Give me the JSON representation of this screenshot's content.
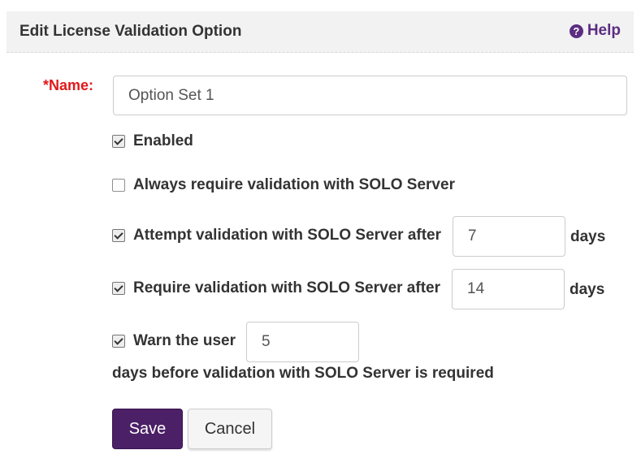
{
  "header": {
    "title": "Edit License Validation Option",
    "help_label": "Help",
    "help_icon": "question-circle-icon"
  },
  "form": {
    "name_label": "*Name:",
    "name_value": "Option Set 1",
    "enabled": {
      "label": "Enabled",
      "checked": true
    },
    "always_require": {
      "label": "Always require validation with SOLO Server",
      "checked": false
    },
    "attempt": {
      "label": "Attempt validation with SOLO Server after",
      "value": "7",
      "unit": "days",
      "checked": true
    },
    "require": {
      "label": "Require validation with SOLO Server after",
      "value": "14",
      "unit": "days",
      "checked": true
    },
    "warn": {
      "label": "Warn the user",
      "value": "5",
      "trailing": "days before validation with SOLO Server is required",
      "checked": true
    }
  },
  "buttons": {
    "save": "Save",
    "cancel": "Cancel"
  },
  "colors": {
    "accent": "#4b2066",
    "required": "#e0191b",
    "help": "#5c2d82"
  }
}
